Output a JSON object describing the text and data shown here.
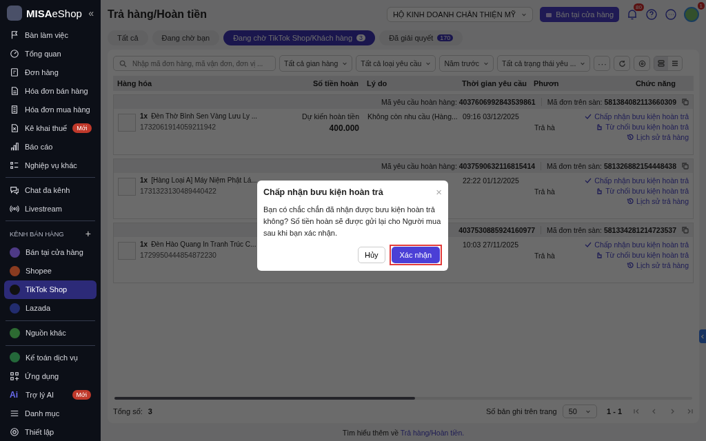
{
  "sidebar": {
    "brand": "MISA",
    "brand_suffix": "eShop",
    "collapse": "«",
    "items": [
      {
        "kind": "nav",
        "label": "Bàn làm việc",
        "selected": false
      },
      {
        "kind": "nav",
        "label": "Tổng quan",
        "selected": false
      },
      {
        "kind": "nav",
        "label": "Đơn hàng",
        "selected": false
      },
      {
        "kind": "nav",
        "label": "Hóa đơn bán hàng",
        "selected": false
      },
      {
        "kind": "nav",
        "label": "Hóa đơn mua hàng",
        "selected": false
      },
      {
        "kind": "nav",
        "label": "Kê khai thuế",
        "selected": false,
        "badge": "Mới"
      },
      {
        "kind": "nav",
        "label": "Báo cáo",
        "selected": false
      },
      {
        "kind": "nav",
        "label": "Nghiệp vụ khác",
        "selected": false
      },
      {
        "kind": "divider"
      },
      {
        "kind": "nav",
        "label": "Chat đa kênh",
        "selected": false
      },
      {
        "kind": "nav",
        "label": "Livestream",
        "selected": false
      },
      {
        "kind": "divider"
      },
      {
        "kind": "section",
        "label": "KÊNH BÁN HÀNG",
        "action": "+"
      },
      {
        "kind": "channel",
        "label": "Bán tại cửa hàng",
        "selected": false,
        "color": "#4e3a86"
      },
      {
        "kind": "channel",
        "label": "Shopee",
        "selected": false,
        "color": "#8a3b20"
      },
      {
        "kind": "channel",
        "label": "TikTok Shop",
        "selected": true,
        "color": "#111111"
      },
      {
        "kind": "channel",
        "label": "Lazada",
        "selected": false,
        "color": "#222c6e"
      },
      {
        "kind": "divider"
      },
      {
        "kind": "channel",
        "label": "Nguồn khác",
        "selected": false,
        "color": "#2d6a32"
      },
      {
        "kind": "divider"
      },
      {
        "kind": "channel",
        "label": "Kế toán dịch vụ",
        "selected": false,
        "color": "#24683a"
      },
      {
        "kind": "nav",
        "label": "Ứng dụng",
        "selected": false
      },
      {
        "kind": "ai",
        "label": "Trợ lý AI",
        "selected": false,
        "badge": "Mới",
        "glyph": "Ai"
      },
      {
        "kind": "nav",
        "label": "Danh mục",
        "selected": false
      },
      {
        "kind": "nav",
        "label": "Thiết lập",
        "selected": false
      }
    ]
  },
  "header": {
    "title": "Trả hàng/Hoàn tiền",
    "store": "HỘ KINH DOANH CHÂN THIỆN MỸ",
    "pos_button": "Bán tại cửa hàng",
    "notifications": "80",
    "avatar_badge": "1"
  },
  "tabs": [
    {
      "label": "Tất cả",
      "selected": false
    },
    {
      "label": "Đang chờ bạn",
      "selected": false
    },
    {
      "label": "Đang chờ TikTok Shop/Khách hàng",
      "count": "3",
      "selected": true
    },
    {
      "label": "Đã giải quyết",
      "count": "170",
      "selected": false
    }
  ],
  "filters": {
    "search": {
      "placeholder": "Nhập mã đơn hàng, mã vận đơn, đơn vị ..."
    },
    "dropdowns": [
      "Tất cả gian hàng",
      "Tất cả loại yêu cầu",
      "Năm trước",
      "Tất cả trạng thái yêu ..."
    ],
    "more": "···"
  },
  "table": {
    "columns": [
      "Hàng hóa",
      "Số tiền hoàn",
      "Lý do",
      "Thời gian yêu cầu",
      "Phươn",
      "Chức năng"
    ],
    "rows": [
      {
        "request_label": "Mã yêu cầu hoàn hàng:",
        "request_code": "4037606992843539861",
        "order_label": "Mã đơn trên sàn:",
        "order_code": "581384082113660309",
        "quantity": "1x",
        "product": "Đèn Thờ Bình Sen Vàng Lưu Ly ...",
        "sku": "1732061914059211942",
        "amount_caption": "Dự kiến hoàn tiền",
        "amount": "400.000",
        "reason": "Không còn nhu cầu (Hàng...",
        "time": "09:16 03/12/2025",
        "method": "Trả hà",
        "actions": [
          "Chấp nhận bưu kiện hoàn trả",
          "Từ chối bưu kiện hoàn trả",
          "Lịch sử trả hàng"
        ]
      },
      {
        "request_label": "Mã yêu cầu hoàn hàng:",
        "request_code": "4037590632116815414",
        "order_label": "Mã đơn trên sàn:",
        "order_code": "581326882154448438",
        "quantity": "1x",
        "product": "[Hàng Loại A] Máy Niệm Phật Lá...",
        "sku": "1731323130489440422",
        "time": "22:22 01/12/2025",
        "method": "Trả hà",
        "actions": [
          "Chấp nhận bưu kiện hoàn trả",
          "Từ chối bưu kiện hoàn trả",
          "Lịch sử trả hàng"
        ]
      },
      {
        "request_code": "4037530885924160977",
        "order_label": "Mã đơn trên sàn:",
        "order_code": "581334281214723537",
        "quantity": "1x",
        "product": "Đèn Hào Quang In Tranh Trúc C...",
        "sku": "1729950444854872230",
        "time": "10:03 27/11/2025",
        "method": "Trả hà",
        "actions": [
          "Chấp nhận bưu kiện hoàn trả",
          "Từ chối bưu kiện hoàn trả",
          "Lịch sử trả hàng"
        ]
      }
    ]
  },
  "footer": {
    "total_label": "Tổng số:",
    "total": "3",
    "page_size_label": "Số bản ghi trên trang",
    "page_size": "50",
    "range": "1 - 1"
  },
  "help": {
    "text": "Tìm hiểu thêm về",
    "link": "Trả hàng/Hoàn tiền."
  },
  "dialog": {
    "title": "Chấp nhận bưu kiện hoàn trả",
    "close": "×",
    "message": "Bạn có chắc chắn đã nhận được bưu kiện hoàn trả không? Số tiền hoàn sẽ được gửi lại cho Người mua sau khi bạn xác nhận.",
    "cancel": "Hủy",
    "confirm": "Xác nhận",
    "confirm_highlighted": true
  }
}
